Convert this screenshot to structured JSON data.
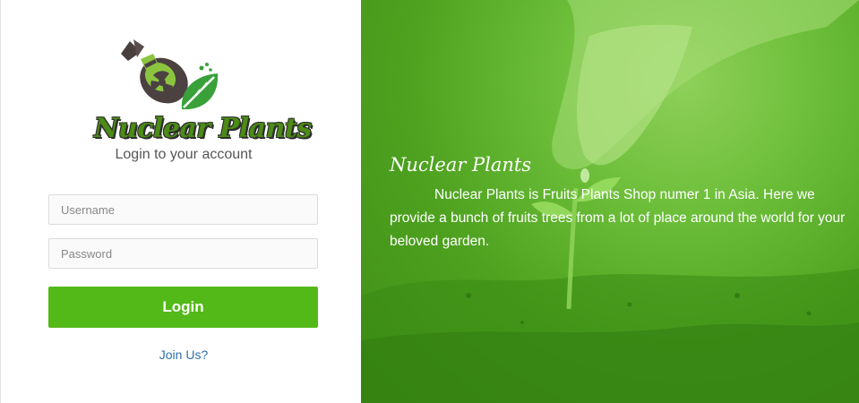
{
  "login_panel": {
    "logo_text": "Nuclear Plants",
    "subtitle": "Login to your account",
    "username": {
      "placeholder": "Username",
      "value": ""
    },
    "password": {
      "placeholder": "Password",
      "value": ""
    },
    "login_label": "Login",
    "join_label": "Join Us?"
  },
  "hero": {
    "title": "Nuclear Plants",
    "description": "Nuclear Plants is Fruits Plants Shop numer 1 in Asia. Here we provide a bunch of fruits trees from a lot of place around the world for your beloved garden."
  },
  "colors": {
    "accent": "#52b918",
    "link": "#2f6fa8",
    "hero_green": "#4ea21f"
  },
  "icons": {
    "logo": "bomb-with-leaf-icon"
  }
}
